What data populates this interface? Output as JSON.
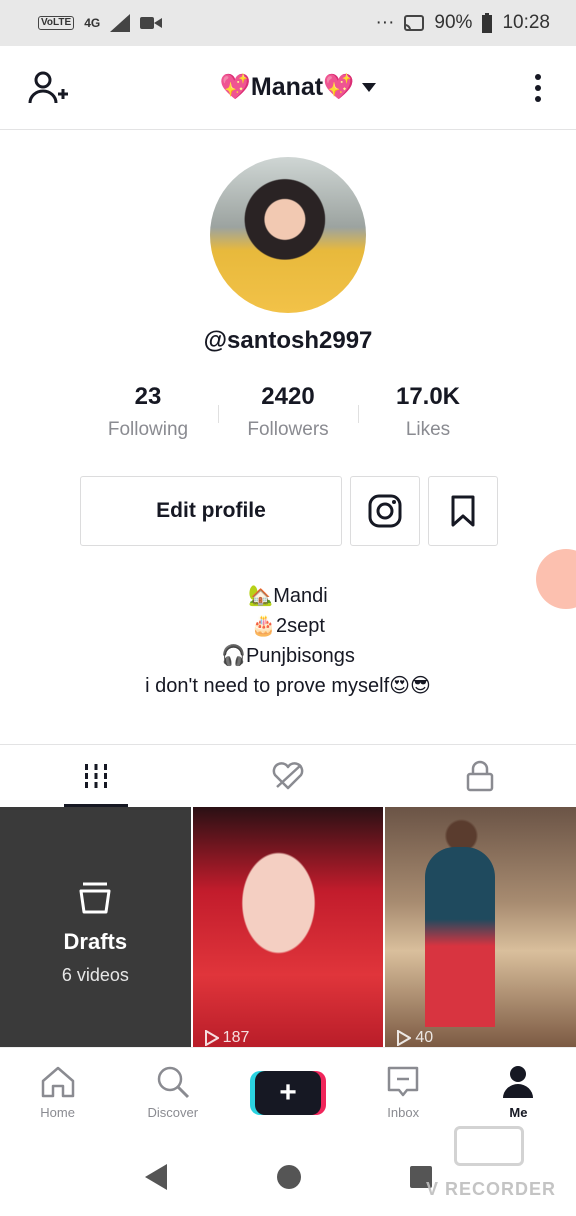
{
  "status_bar": {
    "volte": "VoLTE",
    "network": "4G",
    "dots": "···",
    "battery": "90%",
    "time": "10:28"
  },
  "topnav": {
    "account_name": "💖Manat💖",
    "add_user_icon": "add-user-icon",
    "more_icon": "more-icon"
  },
  "profile": {
    "handle": "@santosh2997",
    "stats": [
      {
        "value": "23",
        "label": "Following"
      },
      {
        "value": "2420",
        "label": "Followers"
      },
      {
        "value": "17.0K",
        "label": "Likes"
      }
    ],
    "edit_profile_label": "Edit profile",
    "bio": [
      "🏡Mandi",
      "🎂2sept",
      "🎧Punjbisongs",
      "i don't need to prove myself😍😎"
    ]
  },
  "grid": {
    "drafts_title": "Drafts",
    "drafts_subtitle": "6 videos",
    "videos": [
      {
        "views": "187"
      },
      {
        "views": "40"
      }
    ]
  },
  "bottom_nav": [
    {
      "label": "Home",
      "icon": "home-icon"
    },
    {
      "label": "Discover",
      "icon": "search-icon"
    },
    {
      "label": "",
      "icon": "plus-icon"
    },
    {
      "label": "Inbox",
      "icon": "inbox-icon"
    },
    {
      "label": "Me",
      "icon": "person-icon"
    }
  ],
  "watermark": "V RECORDER",
  "colors": {
    "accent_red": "#f0255a",
    "accent_cyan": "#2bd3e0",
    "text_primary": "#161823",
    "text_secondary": "#8a8b91"
  }
}
